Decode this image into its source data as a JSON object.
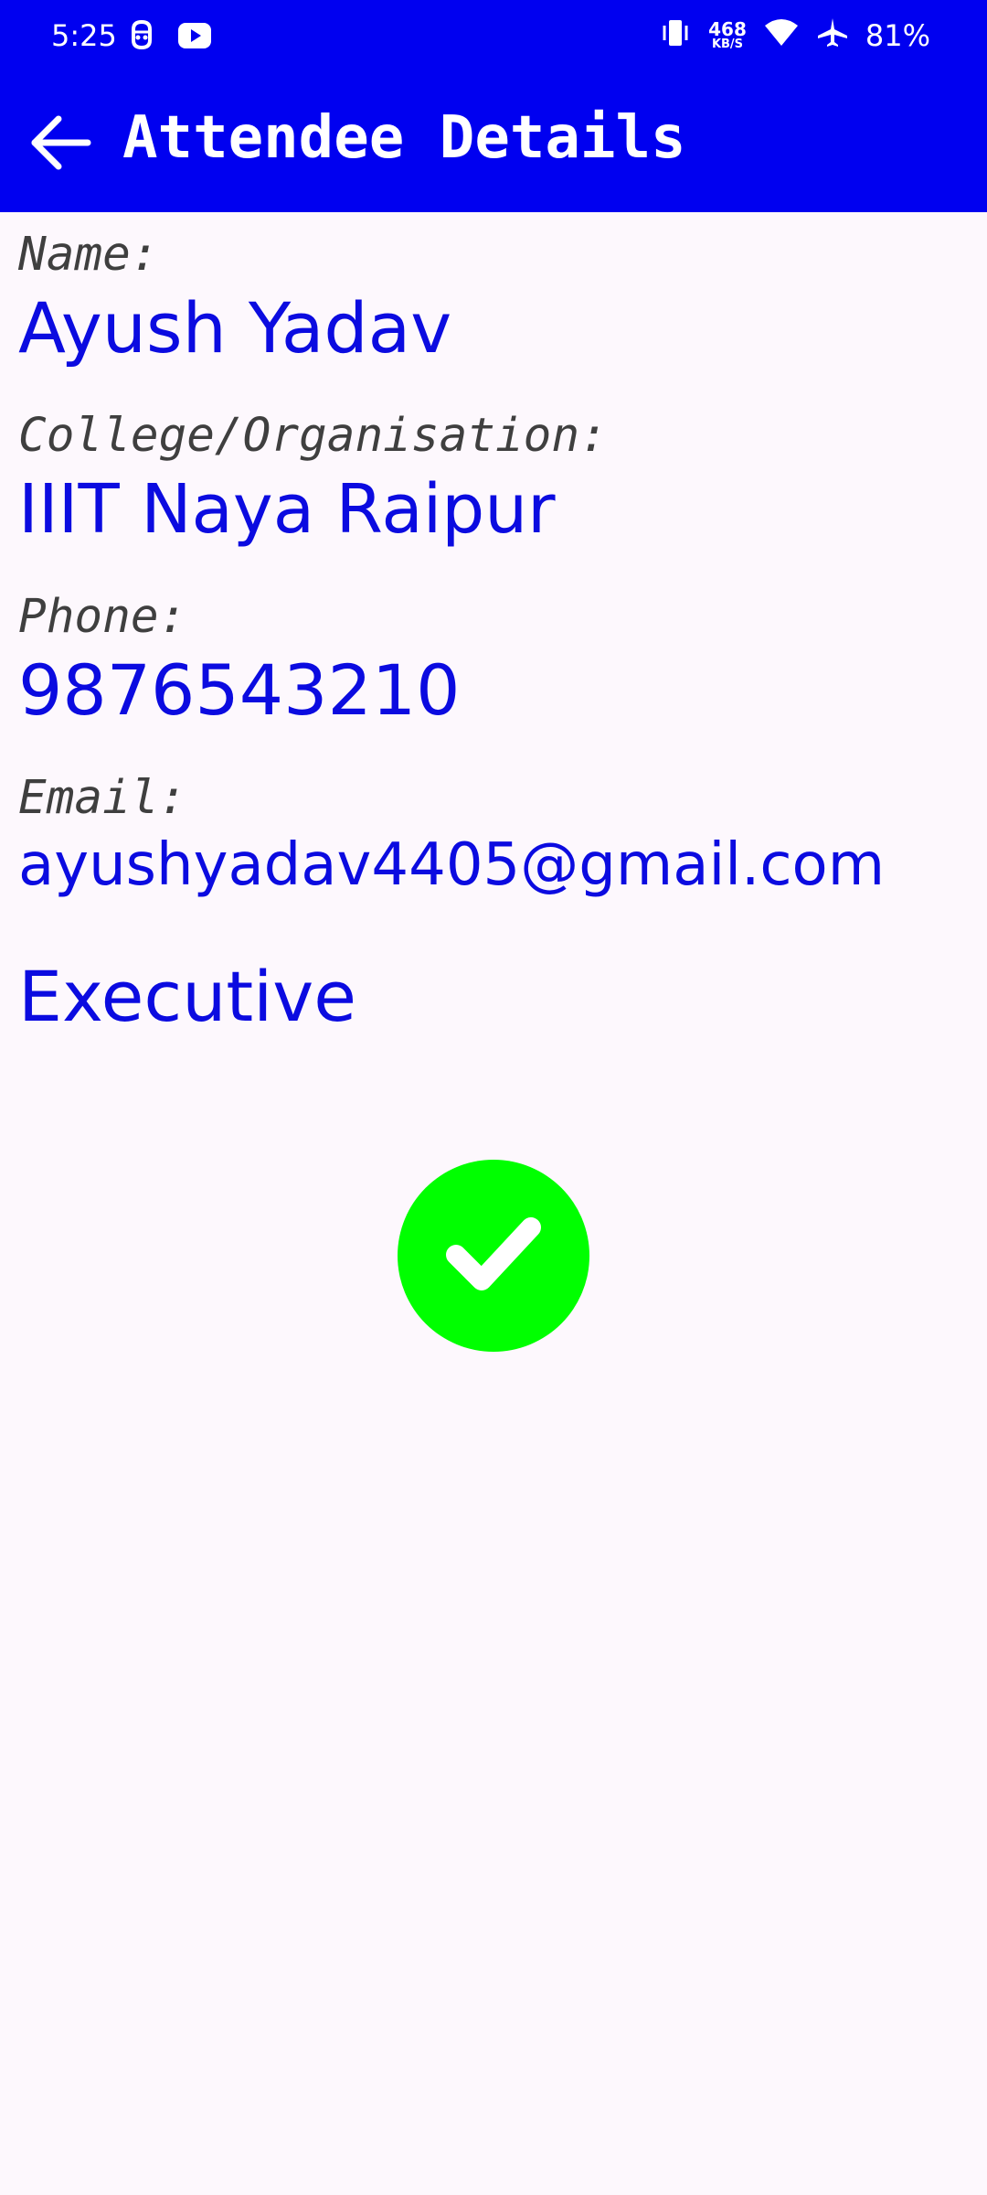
{
  "status_bar": {
    "time": "5:25",
    "left_icons": [
      "assistant-icon",
      "youtube-icon"
    ],
    "net_speed_value": "468",
    "net_speed_unit": "KB/S",
    "right_icons": [
      "vibrate-icon",
      "wifi-icon",
      "airplane-icon"
    ],
    "battery": "81%"
  },
  "toolbar": {
    "title": "Attendee Details",
    "back_icon": "arrow-left-icon"
  },
  "attendee": {
    "name_label": "Name:",
    "name": "Ayush Yadav",
    "college_label": "College/Organisation:",
    "college": "IIIT Naya Raipur",
    "phone_label": "Phone:",
    "phone": "9876543210",
    "email_label": "Email:",
    "email": "ayushyadav4405@gmail.com",
    "role": "Executive"
  },
  "verification": {
    "icon": "check-icon",
    "color": "#00ff00"
  },
  "colors": {
    "header": "#0000f0",
    "value_text": "#0b0be0",
    "label_text": "#3f3f3f",
    "background": "#fdf8fd"
  }
}
